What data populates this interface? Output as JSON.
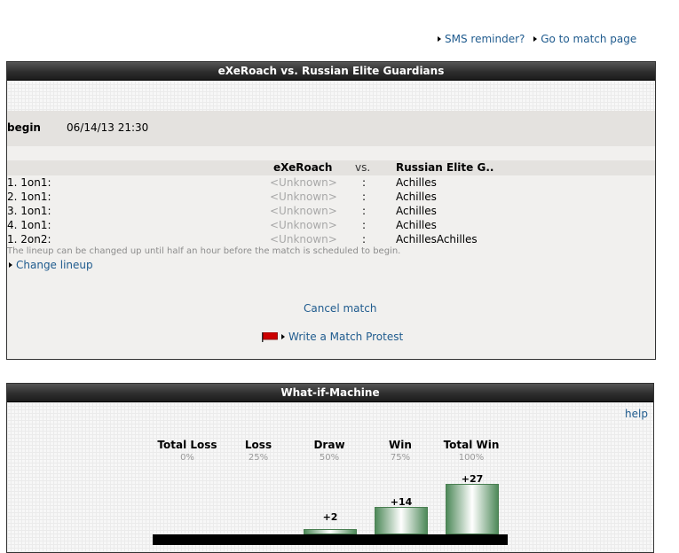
{
  "top_links": {
    "sms": "SMS reminder?",
    "match_page": "Go to match page"
  },
  "match": {
    "title": "eXeRoach vs. Russian Elite Guardians",
    "begin_label": "begin",
    "begin_date": "06/14/13 21:30",
    "home_team": "eXeRoach",
    "vs": "vs.",
    "away_team": "Russian Elite G..",
    "lineup": [
      {
        "label": "1. 1on1:",
        "home": "<Unknown>",
        "sep": ":",
        "away": "Achilles"
      },
      {
        "label": "2. 1on1:",
        "home": "<Unknown>",
        "sep": ":",
        "away": "Achilles"
      },
      {
        "label": "3. 1on1:",
        "home": "<Unknown>",
        "sep": ":",
        "away": "Achilles"
      },
      {
        "label": "4. 1on1:",
        "home": "<Unknown>",
        "sep": ":",
        "away": "Achilles"
      },
      {
        "label": "1. 2on2:",
        "home": "<Unknown>",
        "sep": ":",
        "away": "AchillesAchilles"
      }
    ],
    "note": "The lineup can be changed up until half an hour before the match is scheduled to begin.",
    "change_lineup": "Change lineup",
    "cancel_match": "Cancel match",
    "write_protest": "Write a Match Protest",
    "flag_color": "#cc0000"
  },
  "whatif": {
    "title": "What-if-Machine",
    "help": "help",
    "columns": [
      {
        "title": "Total Loss",
        "pct": "0%",
        "value": ""
      },
      {
        "title": "Loss",
        "pct": "25%",
        "value": ""
      },
      {
        "title": "Draw",
        "pct": "50%",
        "value": "+2"
      },
      {
        "title": "Win",
        "pct": "75%",
        "value": "+14"
      },
      {
        "title": "Total Win",
        "pct": "100%",
        "value": "+27"
      }
    ],
    "bar_color": "#4f8a5a"
  }
}
